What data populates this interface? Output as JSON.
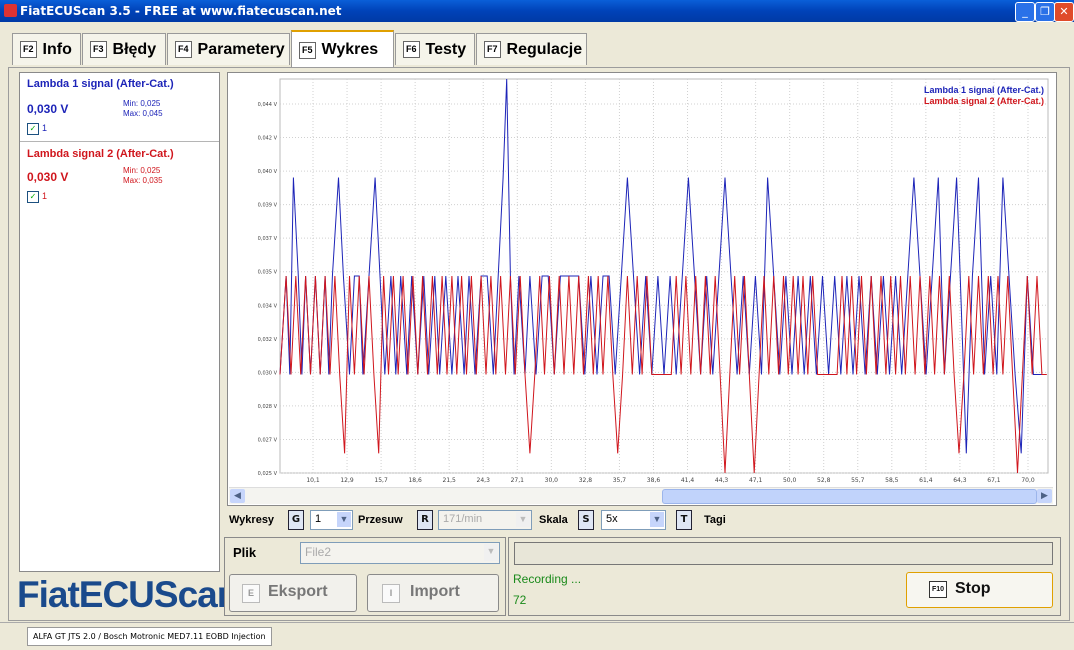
{
  "window": {
    "title": "FiatECUScan 3.5 - FREE at www.fiatecuscan.net"
  },
  "tabs": [
    {
      "key": "F2",
      "label": "Info",
      "active": false
    },
    {
      "key": "F3",
      "label": "Błędy",
      "active": false
    },
    {
      "key": "F4",
      "label": "Parametery",
      "active": false
    },
    {
      "key": "F5",
      "label": "Wykres",
      "active": true
    },
    {
      "key": "F6",
      "label": "Testy",
      "active": false
    },
    {
      "key": "F7",
      "label": "Regulacje",
      "active": false
    }
  ],
  "signals": [
    {
      "title": "Lambda 1 signal (After-Cat.)",
      "value": "0,030 V",
      "min": "Min: 0,025",
      "max": "Max: 0,045",
      "check_label": "1",
      "color": "#1d24b8"
    },
    {
      "title": "Lambda signal 2 (After-Cat.)",
      "value": "0,030 V",
      "min": "Min: 0,025",
      "max": "Max: 0,035",
      "check_label": "1",
      "color": "#d0161d"
    }
  ],
  "logo": "FiatECUScan",
  "chart_data": {
    "type": "line",
    "legend_position": "top-right",
    "legend": [
      "Lambda 1 signal (After-Cat.)",
      "Lambda signal 2 (After-Cat.)"
    ],
    "y_ticks": [
      "0,044 V",
      "0,042 V",
      "0,040 V",
      "0,039 V",
      "0,037 V",
      "0,035 V",
      "0,034 V",
      "0,032 V",
      "0,030 V",
      "0,028 V",
      "0,027 V",
      "0,025 V"
    ],
    "x_ticks": [
      "10,1",
      "12,9",
      "15,7",
      "18,6",
      "21,5",
      "24,3",
      "27,1",
      "30,0",
      "32,8",
      "35,7",
      "38,6",
      "41,4",
      "44,3",
      "47,1",
      "50,0",
      "52,8",
      "55,7",
      "58,5",
      "61,4",
      "64,3",
      "67,1",
      "70,0"
    ],
    "ylim": [
      0.025,
      0.045
    ],
    "xlim": [
      8.5,
      71.5
    ],
    "grid": true,
    "series": [
      {
        "name": "Lambda 1 signal (After-Cat.)",
        "color": "#1d24b8",
        "x": [
          8.5,
          9.0,
          9.3,
          9.6,
          10.0,
          10.3,
          10.6,
          11.0,
          11.4,
          11.8,
          12.2,
          12.5,
          12.8,
          13.3,
          13.7,
          14.2,
          14.6,
          15.0,
          15.3,
          15.8,
          16.3,
          16.7,
          17.1,
          17.6,
          18.0,
          18.4,
          18.9,
          19.3,
          19.8,
          20.3,
          20.7,
          21.2,
          21.6,
          22.1,
          22.6,
          23.1,
          23.6,
          24.0,
          24.5,
          25.0,
          25.5,
          26.0,
          26.4,
          26.8,
          27.1,
          27.4,
          27.7,
          28.1,
          28.6,
          29.0,
          29.5,
          30.0,
          30.5,
          31.0,
          31.5,
          32.0,
          32.5,
          33.0,
          33.5,
          34.0,
          34.5,
          35.0,
          35.5,
          36.0,
          36.5,
          37.0,
          37.5,
          38.0,
          38.5,
          39.0,
          39.5,
          40.0,
          40.5,
          41.0,
          41.5,
          42.0,
          42.5,
          43.0,
          43.5,
          44.0,
          44.5,
          45.0,
          45.5,
          46.0,
          46.5,
          47.0,
          47.5,
          48.0,
          48.5,
          49.0,
          49.5,
          50.0,
          50.5,
          51.0,
          51.5,
          52.0,
          52.5,
          53.0,
          53.5,
          54.0,
          54.5,
          55.0,
          55.5,
          56.0,
          56.5,
          57.0,
          57.5,
          58.0,
          58.5,
          59.0,
          59.5,
          60.0,
          60.5,
          61.0,
          61.5,
          62.0,
          62.5,
          63.0,
          63.5,
          64.0,
          64.3,
          64.8,
          65.3,
          65.8,
          66.3,
          66.8,
          67.3,
          67.8,
          68.3,
          68.8,
          69.3,
          69.8,
          70.3,
          70.8,
          71.3
        ],
        "values": [
          0.03,
          0.035,
          0.03,
          0.04,
          0.035,
          0.03,
          0.035,
          0.03,
          0.035,
          0.03,
          0.035,
          0.03,
          0.035,
          0.04,
          0.035,
          0.03,
          0.035,
          0.035,
          0.03,
          0.035,
          0.04,
          0.035,
          0.03,
          0.035,
          0.03,
          0.035,
          0.03,
          0.035,
          0.03,
          0.035,
          0.03,
          0.035,
          0.03,
          0.035,
          0.03,
          0.035,
          0.03,
          0.035,
          0.03,
          0.035,
          0.035,
          0.03,
          0.035,
          0.04,
          0.045,
          0.035,
          0.03,
          0.035,
          0.03,
          0.035,
          0.03,
          0.035,
          0.035,
          0.03,
          0.035,
          0.035,
          0.035,
          0.035,
          0.03,
          0.035,
          0.03,
          0.035,
          0.035,
          0.03,
          0.035,
          0.04,
          0.035,
          0.03,
          0.035,
          0.03,
          0.035,
          0.03,
          0.035,
          0.03,
          0.035,
          0.04,
          0.035,
          0.03,
          0.035,
          0.03,
          0.035,
          0.04,
          0.035,
          0.03,
          0.035,
          0.03,
          0.035,
          0.03,
          0.04,
          0.035,
          0.03,
          0.035,
          0.03,
          0.035,
          0.03,
          0.035,
          0.03,
          0.035,
          0.03,
          0.035,
          0.03,
          0.035,
          0.03,
          0.035,
          0.03,
          0.035,
          0.03,
          0.035,
          0.03,
          0.035,
          0.03,
          0.035,
          0.04,
          0.035,
          0.03,
          0.035,
          0.04,
          0.03,
          0.035,
          0.04,
          0.035,
          0.026,
          0.035,
          0.04,
          0.03,
          0.035,
          0.03,
          0.04,
          0.035,
          0.03,
          0.026,
          0.035,
          0.03,
          0.03,
          0.03
        ]
      },
      {
        "name": "Lambda signal 2 (After-Cat.)",
        "color": "#d0161d",
        "x": [
          8.5,
          9.0,
          9.4,
          9.8,
          10.2,
          10.6,
          11.0,
          11.4,
          11.8,
          12.2,
          12.6,
          13.0,
          13.4,
          13.8,
          14.2,
          14.6,
          15.0,
          15.4,
          15.8,
          16.2,
          16.6,
          17.0,
          17.4,
          17.8,
          18.2,
          18.6,
          19.0,
          19.4,
          19.8,
          20.2,
          20.6,
          21.0,
          21.4,
          21.8,
          22.2,
          22.6,
          23.0,
          23.4,
          23.8,
          24.2,
          24.6,
          25.0,
          25.4,
          25.8,
          26.2,
          26.6,
          27.0,
          27.4,
          27.8,
          28.2,
          28.6,
          29.0,
          29.4,
          29.8,
          30.2,
          30.6,
          31.0,
          31.4,
          31.8,
          32.2,
          32.6,
          33.0,
          33.4,
          33.8,
          34.2,
          34.6,
          35.0,
          35.4,
          35.8,
          36.2,
          36.6,
          37.0,
          37.4,
          37.8,
          38.2,
          38.6,
          39.0,
          39.4,
          39.8,
          40.2,
          40.6,
          41.0,
          41.4,
          41.8,
          42.2,
          42.6,
          43.0,
          43.4,
          43.8,
          44.2,
          44.6,
          45.0,
          45.4,
          45.8,
          46.2,
          46.6,
          47.0,
          47.4,
          47.8,
          48.2,
          48.6,
          49.0,
          49.4,
          49.8,
          50.2,
          50.6,
          51.0,
          51.4,
          51.8,
          52.2,
          52.6,
          53.0,
          53.4,
          53.8,
          54.2,
          54.6,
          55.0,
          55.4,
          55.8,
          56.2,
          56.6,
          57.0,
          57.4,
          57.8,
          58.2,
          58.6,
          59.0,
          59.4,
          59.8,
          60.2,
          60.6,
          61.0,
          61.4,
          61.8,
          62.2,
          62.6,
          63.0,
          63.4,
          63.8,
          64.2,
          64.6,
          65.0,
          65.4,
          65.8,
          66.2,
          66.6,
          67.0,
          67.4,
          67.8,
          68.2,
          68.6,
          69.0,
          69.4,
          69.8,
          70.2,
          70.6,
          71.0,
          71.4
        ],
        "values": [
          0.03,
          0.035,
          0.03,
          0.035,
          0.03,
          0.035,
          0.03,
          0.035,
          0.03,
          0.035,
          0.03,
          0.035,
          0.03,
          0.026,
          0.035,
          0.03,
          0.035,
          0.03,
          0.035,
          0.03,
          0.026,
          0.035,
          0.03,
          0.035,
          0.03,
          0.035,
          0.03,
          0.035,
          0.03,
          0.035,
          0.03,
          0.035,
          0.03,
          0.035,
          0.03,
          0.035,
          0.03,
          0.035,
          0.03,
          0.035,
          0.03,
          0.035,
          0.03,
          0.035,
          0.03,
          0.035,
          0.03,
          0.035,
          0.03,
          0.035,
          0.03,
          0.026,
          0.03,
          0.035,
          0.03,
          0.035,
          0.03,
          0.035,
          0.03,
          0.035,
          0.03,
          0.035,
          0.03,
          0.035,
          0.03,
          0.035,
          0.03,
          0.035,
          0.03,
          0.026,
          0.03,
          0.035,
          0.03,
          0.035,
          0.03,
          0.035,
          0.03,
          0.03,
          0.03,
          0.03,
          0.03,
          0.035,
          0.03,
          0.035,
          0.03,
          0.035,
          0.03,
          0.035,
          0.03,
          0.035,
          0.03,
          0.025,
          0.03,
          0.035,
          0.03,
          0.035,
          0.03,
          0.025,
          0.03,
          0.035,
          0.03,
          0.035,
          0.03,
          0.035,
          0.03,
          0.035,
          0.03,
          0.035,
          0.03,
          0.035,
          0.03,
          0.03,
          0.03,
          0.03,
          0.03,
          0.035,
          0.03,
          0.035,
          0.03,
          0.035,
          0.03,
          0.035,
          0.03,
          0.035,
          0.03,
          0.035,
          0.03,
          0.035,
          0.03,
          0.035,
          0.03,
          0.035,
          0.03,
          0.035,
          0.03,
          0.035,
          0.03,
          0.035,
          0.03,
          0.026,
          0.03,
          0.035,
          0.03,
          0.035,
          0.03,
          0.035,
          0.03,
          0.035,
          0.03,
          0.035,
          0.03,
          0.025,
          0.03,
          0.035,
          0.03,
          0.035,
          0.03,
          0.03
        ]
      }
    ]
  },
  "controls": {
    "wykresy_label": "Wykresy",
    "wykresy_key": "G",
    "wykresy_value": "1",
    "przesuw_label": "Przesuw",
    "przesuw_key": "R",
    "przesuw_value": "171/min",
    "skala_label": "Skala",
    "skala_key": "S",
    "skala_value": "5x",
    "tagi_key": "T",
    "tagi_label": "Tagi"
  },
  "file": {
    "label": "Plik",
    "value": "File2",
    "export_key": "E",
    "export_label": "Eksport",
    "import_key": "I",
    "import_label": "Import"
  },
  "recording": {
    "status": "Recording ...",
    "count": "72",
    "stop_key": "F10",
    "stop_label": "Stop"
  },
  "statusbar": {
    "text": "ALFA GT JTS 2.0 / Bosch Motronic MED7.11 EOBD Injection"
  }
}
